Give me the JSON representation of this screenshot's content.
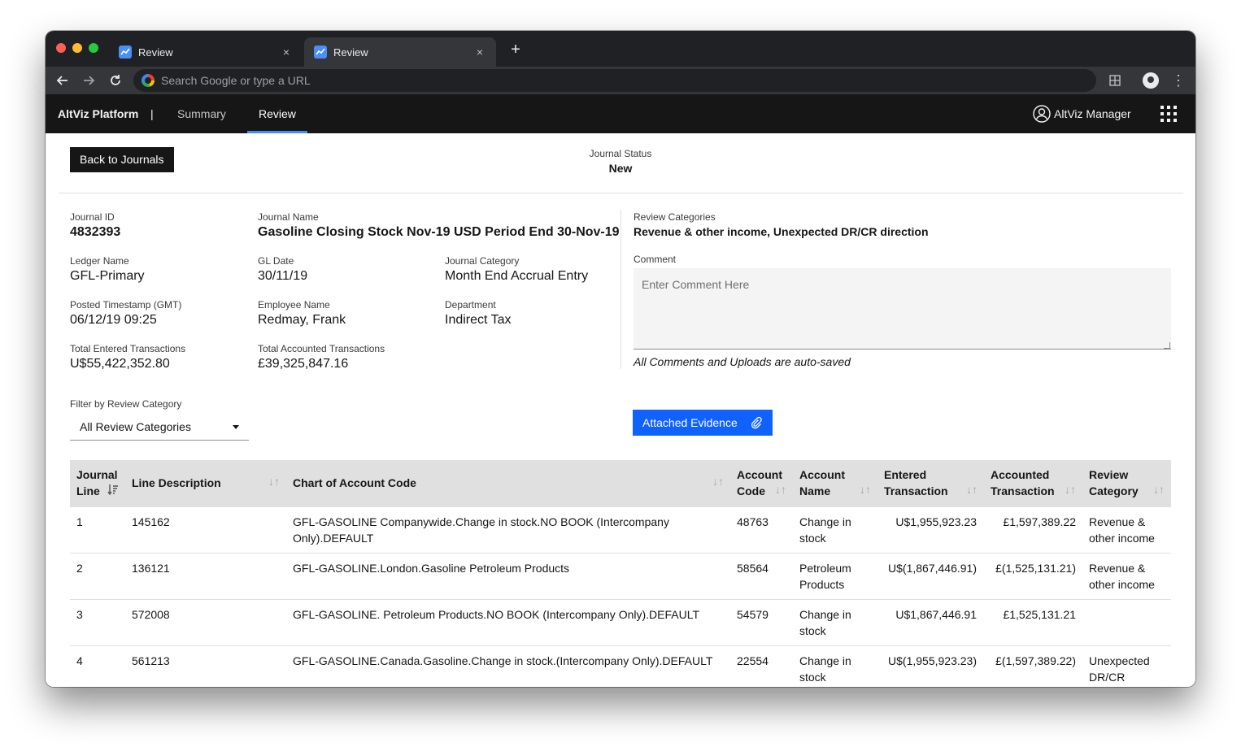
{
  "browser": {
    "tabs": [
      {
        "title": "Review"
      },
      {
        "title": "Review"
      }
    ],
    "close_glyph": "×",
    "new_tab_glyph": "+",
    "omnibox_placeholder": "Search Google or type a URL"
  },
  "app": {
    "brand_prefix": "AltViz",
    "brand_bold": "Platform",
    "separator": "|",
    "nav": [
      {
        "label": "Summary"
      },
      {
        "label": "Review"
      }
    ],
    "user_name": "AltViz Manager"
  },
  "journal": {
    "back_button": "Back to Journals",
    "status_label": "Journal Status",
    "status_value": "New",
    "fields": {
      "journal_id_label": "Journal ID",
      "journal_id": "4832393",
      "journal_name_label": "Journal Name",
      "journal_name": "Gasoline Closing Stock Nov-19 USD Period End 30-Nov-19",
      "ledger_name_label": "Ledger Name",
      "ledger_name": "GFL-Primary",
      "gl_date_label": "GL Date",
      "gl_date": "30/11/19",
      "journal_category_label": "Journal Category",
      "journal_category": "Month End Accrual Entry",
      "posted_label": "Posted Timestamp (GMT)",
      "posted": "06/12/19 09:25",
      "employee_label": "Employee Name",
      "employee": "Redmay, Frank",
      "department_label": "Department",
      "department": "Indirect Tax",
      "total_entered_label": "Total Entered Transactions",
      "total_entered": "U$55,422,352.80",
      "total_accounted_label": "Total Accounted Transactions",
      "total_accounted": "£39,325,847.16"
    },
    "review_categories_label": "Review Categories",
    "review_categories": "Revenue & other income, Unexpected DR/CR direction",
    "comment_label": "Comment",
    "comment_placeholder": "Enter Comment Here",
    "autosave_note": "All Comments and Uploads are auto-saved",
    "filter_label": "Filter by Review Category",
    "filter_value": "All Review Categories",
    "evidence_button": "Attached Evidence"
  },
  "table": {
    "headers": {
      "journal_line": [
        "Journal",
        "Line"
      ],
      "line_description": "Line Description",
      "coa_code": "Chart of Account Code",
      "account_code": [
        "Account",
        "Code"
      ],
      "account_name": [
        "Account",
        "Name"
      ],
      "entered": [
        "Entered",
        "Transaction"
      ],
      "accounted": [
        "Accounted",
        "Transaction"
      ],
      "review_category": [
        "Review",
        "Category"
      ]
    },
    "sort_glyph": "↓↑",
    "rows": [
      {
        "line": "1",
        "desc": "145162",
        "coa": [
          "GFL-GASOLINE Companywide.Change in stock.NO BOOK (Intercompany",
          "Only).DEFAULT"
        ],
        "acct_code": "48763",
        "acct_name": [
          "Change in",
          "stock"
        ],
        "entered": "U$1,955,923.23",
        "accounted": "£1,597,389.22",
        "category": [
          "Revenue &",
          "other income"
        ]
      },
      {
        "line": "2",
        "desc": "136121",
        "coa": [
          "GFL-GASOLINE.London.Gasoline Petroleum Products",
          ""
        ],
        "acct_code": "58564",
        "acct_name": [
          "Petroleum",
          "Products"
        ],
        "entered": "U$(1,867,446.91)",
        "accounted": "£(1,525,131.21)",
        "category": [
          "Revenue &",
          "other income"
        ]
      },
      {
        "line": "3",
        "desc": "572008",
        "coa": [
          "GFL-GASOLINE. Petroleum Products.NO BOOK (Intercompany Only).DEFAULT",
          ""
        ],
        "acct_code": "54579",
        "acct_name": [
          "Change in",
          "stock"
        ],
        "entered": "U$1,867,446.91",
        "accounted": "£1,525,131.21",
        "category": [
          "",
          ""
        ]
      },
      {
        "line": "4",
        "desc": "561213",
        "coa": [
          "GFL-GASOLINE.Canada.Gasoline.Change in stock.(Intercompany Only).DEFAULT",
          ""
        ],
        "acct_code": "22554",
        "acct_name": [
          "Change in",
          "stock"
        ],
        "entered": "U$(1,955,923.23)",
        "accounted": "£(1,597,389.22)",
        "category": [
          "Unexpected",
          "DR/CR"
        ]
      }
    ]
  },
  "colors": {
    "header_bg": "#161616",
    "accent_blue": "#0f62fe",
    "nav_underline": "#4589ff"
  }
}
